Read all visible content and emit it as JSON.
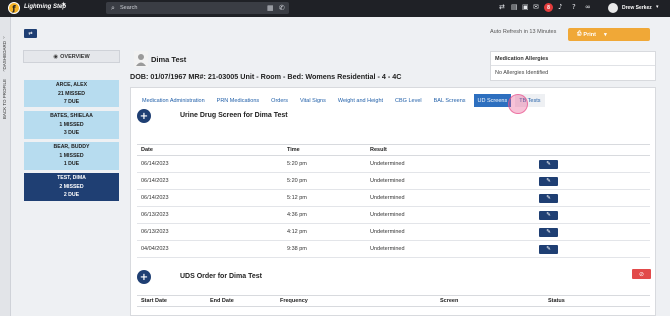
{
  "app": {
    "brand": "Lightning Step",
    "search_placeholder": "Search",
    "notification_count": "8",
    "user_name": "Drew Serkez"
  },
  "rail": {
    "dashboard": "DASHBOARD",
    "back_to_profile": "BACK TO PROFILE"
  },
  "sidebar": {
    "overview_label": "OVERVIEW",
    "patients": [
      {
        "name": "ARCE, ALEX",
        "missed": "21 MISSED",
        "due": "7 DUE"
      },
      {
        "name": "BATES, SHIELAA",
        "missed": "1 MISSED",
        "due": "3 DUE"
      },
      {
        "name": "BEAR, BUDDY",
        "missed": "1 MISSED",
        "due": "1 DUE"
      },
      {
        "name": "TEST, DIMA",
        "missed": "2 MISSED",
        "due": "2 DUE"
      }
    ]
  },
  "header": {
    "patient_name": "Dima Test",
    "patient_info": "DOB: 01/07/1967   MR#: 21-03005   Unit - Room - Bed: Womens Residential - 4 - 4C",
    "auto_refresh": "Auto Refresh in 13 Minutes",
    "print_label": "Print"
  },
  "allergies": {
    "title": "Medication Allergies",
    "value": "No Allergies Identified"
  },
  "tabs": [
    {
      "label": "Medication Administration"
    },
    {
      "label": "PRN Medications"
    },
    {
      "label": "Orders"
    },
    {
      "label": "Vital Signs"
    },
    {
      "label": "Weight and Height"
    },
    {
      "label": "CBG Level"
    },
    {
      "label": "BAL Screens"
    },
    {
      "label": "UD Screens"
    },
    {
      "label": "TB Tests"
    }
  ],
  "ud_section": {
    "title": "Urine Drug Screen for Dima Test",
    "columns": [
      "Date",
      "Time",
      "Result"
    ],
    "rows": [
      {
        "date": "06/14/2023",
        "time": "5:20 pm",
        "result": "Undetermined"
      },
      {
        "date": "06/14/2023",
        "time": "5:20 pm",
        "result": "Undetermined"
      },
      {
        "date": "06/14/2023",
        "time": "5:12 pm",
        "result": "Undetermined"
      },
      {
        "date": "06/13/2023",
        "time": "4:36 pm",
        "result": "Undetermined"
      },
      {
        "date": "06/13/2023",
        "time": "4:12 pm",
        "result": "Undetermined"
      },
      {
        "date": "04/04/2023",
        "time": "9:38 pm",
        "result": "Undetermined"
      }
    ]
  },
  "uds_order": {
    "title": "UDS Order for Dima Test",
    "columns": [
      "Start Date",
      "End Date",
      "Frequency",
      "Screen",
      "Status"
    ]
  }
}
